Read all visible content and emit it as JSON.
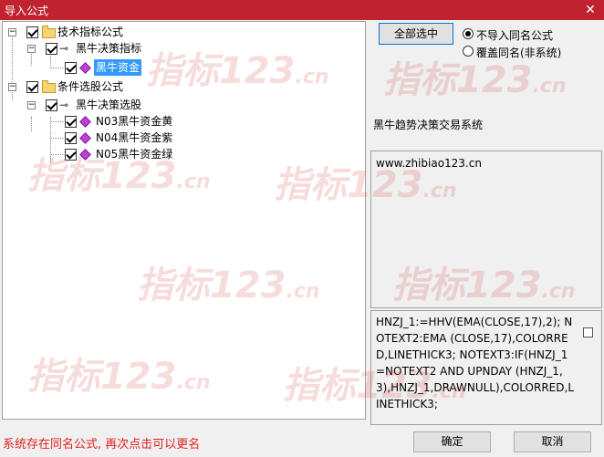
{
  "window": {
    "title": "导入公式",
    "close_glyph": "✕"
  },
  "tree": {
    "items": [
      {
        "label": "技术指标公式",
        "type": "folder",
        "checked": true,
        "expanded": true
      },
      {
        "label": "黑牛决策指标",
        "type": "group",
        "checked": true,
        "expanded": true
      },
      {
        "label": "黑牛资金",
        "type": "formula",
        "checked": true,
        "selected": true
      },
      {
        "label": "条件选股公式",
        "type": "folder",
        "checked": true,
        "expanded": true
      },
      {
        "label": "黑牛决策选股",
        "type": "group",
        "checked": true,
        "expanded": true
      },
      {
        "label": "N03黑牛资金黄",
        "type": "formula",
        "checked": true
      },
      {
        "label": "N04黑牛资金紫",
        "type": "formula",
        "checked": true
      },
      {
        "label": "N05黑牛资金绿",
        "type": "formula",
        "checked": true
      }
    ],
    "expander_glyph": "−",
    "key_icon_glyph": "⊸"
  },
  "select_all_button": "全部选中",
  "options": [
    {
      "label": "不导入同名公式",
      "selected": true
    },
    {
      "label": "覆盖同名(非系统)",
      "selected": false
    }
  ],
  "description": "黑牛趋势决策交易系统",
  "website": "www.zhibiao123.cn",
  "formula_code": "HNZJ_1:=HHV(EMA(CLOSE,17),2); NOTEXT2:EMA (CLOSE,17),COLORRED,LINETHICK3; NOTEXT3:IF(HNZJ_1=NOTEXT2 AND UPNDAY (HNZJ_1,3),HNZJ_1,DRAWNULL),COLORRED,LINETHICK3;",
  "status_message": "系统存在同名公式, 再次点击可以更名",
  "ok_button": "确定",
  "cancel_button": "取消",
  "watermark": {
    "main": "指标123",
    "suffix": ".cn"
  },
  "colors": {
    "titlebar": "#c0222f",
    "selection": "#3399ff",
    "status_text": "#e02020"
  }
}
